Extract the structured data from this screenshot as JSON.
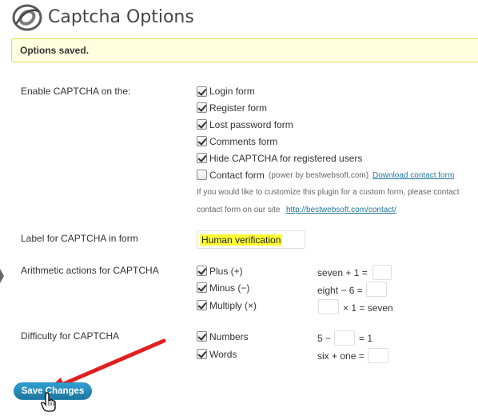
{
  "header": {
    "title": "Captcha Options",
    "logo_icon": "bws-logo-icon"
  },
  "notice": {
    "text": "Options saved."
  },
  "enable_section": {
    "label": "Enable CAPTCHA on the:",
    "options": [
      {
        "label": "Login form",
        "checked": true
      },
      {
        "label": "Register form",
        "checked": true
      },
      {
        "label": "Lost password form",
        "checked": true
      },
      {
        "label": "Comments form",
        "checked": true
      },
      {
        "label": "Hide CAPTCHA for registered users",
        "checked": true
      },
      {
        "label": "Contact form",
        "checked": false
      }
    ],
    "contact_note": "(power by bestwebsoft.com)",
    "download_link": "Download contact form",
    "help_line1": "If you would like to customize this plugin for a custom form, please contact",
    "help_line2_prefix": "contact form on our site",
    "help_line2_link": "http://bestwebsoft.com/contact/"
  },
  "label_section": {
    "label": "Label for CAPTCHA in form",
    "value": "Human verification"
  },
  "arithmetic_section": {
    "label": "Arithmetic actions for CAPTCHA",
    "options": [
      {
        "label": "Plus (+)",
        "checked": true,
        "example_left": "seven + 1 =",
        "example_right": ""
      },
      {
        "label": "Minus (−)",
        "checked": true,
        "example_left": "eight − 6 =",
        "example_right": ""
      },
      {
        "label": "Multiply (×)",
        "checked": true,
        "example_left": "",
        "example_right": "× 1 = seven"
      }
    ]
  },
  "difficulty_section": {
    "label": "Difficulty for CAPTCHA",
    "options": [
      {
        "label": "Numbers",
        "checked": true,
        "example_left": "5 −",
        "example_right": "= 1"
      },
      {
        "label": "Words",
        "checked": true,
        "example_left": "six + one =",
        "example_right": ""
      }
    ]
  },
  "save_button": {
    "label": "Save Changes"
  },
  "colors": {
    "notice_bg": "#ffffe0",
    "notice_border": "#e6db55",
    "button": "#21759b",
    "link": "#21759b",
    "highlight": "#ffff33",
    "arrow": "#e02020"
  }
}
